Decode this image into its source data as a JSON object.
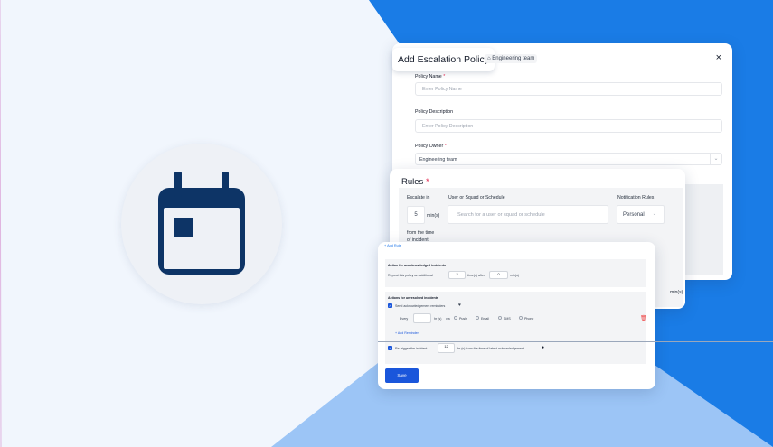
{
  "colors": {
    "accent_blue": "#1a7ce6",
    "light_blue": "#9cc5f6",
    "primary_button": "#1a56db",
    "icon_navy": "#0d3466"
  },
  "decor": {
    "calendar_icon": "calendar-icon"
  },
  "escalation": {
    "title": "Add Escalation Policy",
    "team_tag": "Engineering team",
    "close_icon": "×",
    "policy_name_label": "Policy Name",
    "policy_name_placeholder": "Enter Policy Name",
    "policy_description_label": "Policy Description",
    "policy_description_placeholder": "Enter Policy Description",
    "policy_owner_label": "Policy Owner",
    "policy_owner_value": "Engineering team",
    "required_marker": "*"
  },
  "rules": {
    "title": "Rules",
    "escalate_in_label": "Escalate in",
    "escalate_in_value": "5",
    "escalate_unit": "min(s)",
    "from_time_line1": "from the time",
    "from_time_line2": "of incident",
    "target_label": "User or Squad or Schedule",
    "target_placeholder": "Search for a user or squad or schedule",
    "notification_label": "Notification Rules",
    "notification_value": "Personal",
    "partial_unit": "min(s)"
  },
  "actions": {
    "add_rule": "+ Add Rule",
    "unack_title": "Action for unacknowledged incidents",
    "repeat_text": "Repeat this policy an additional",
    "repeat_value": "3",
    "times_after": "time(s) after",
    "minutes_value": "0",
    "mins": "min(s)",
    "unresolved_title": "Actions for unresolved incidents",
    "send_reminders": "Send acknowledgement reminders",
    "every": "Every",
    "every_value": "",
    "hr_unit": "hr (s)",
    "via": "via",
    "channels": [
      "Push",
      "Email",
      "SMS",
      "Phone"
    ],
    "add_reminder": "+ Add Reminder",
    "retrigger_text": "Re-trigger the incident",
    "retrigger_value": "12",
    "retrigger_suffix": "hr (s) from the time of latest acknowledgement",
    "save": "Save"
  }
}
